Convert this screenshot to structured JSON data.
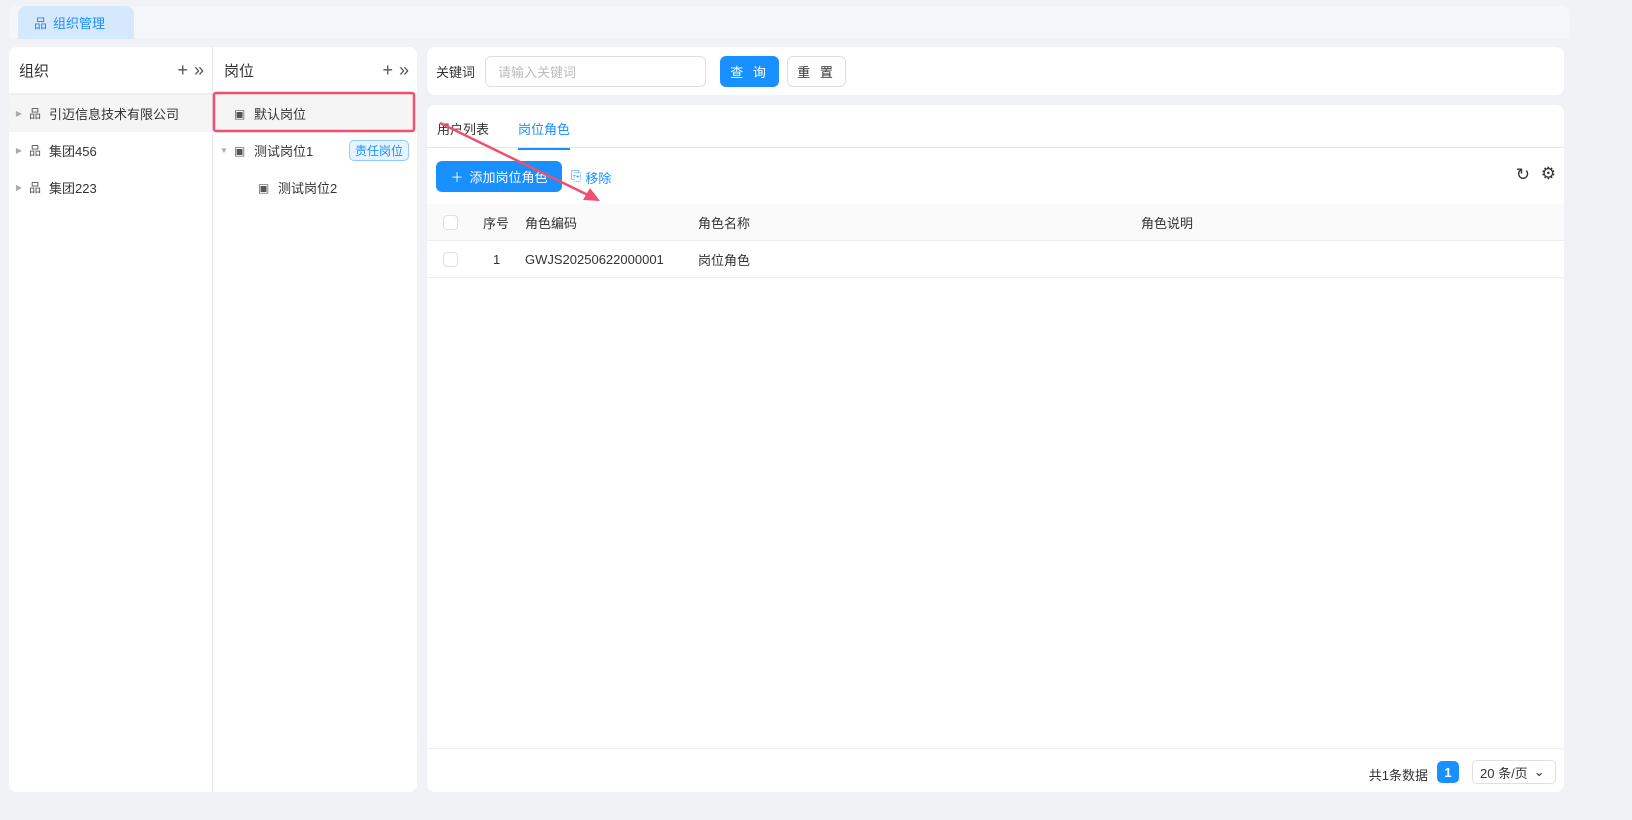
{
  "tabbar": {
    "tab": "组织管理"
  },
  "org": {
    "title": "组织",
    "items": [
      {
        "label": "引迈信息技术有限公司"
      },
      {
        "label": "集团456"
      },
      {
        "label": "集团223"
      }
    ]
  },
  "post": {
    "title": "岗位",
    "items": [
      {
        "label": "默认岗位"
      },
      {
        "label": "测试岗位1",
        "badge": "责任岗位"
      },
      {
        "label": "测试岗位2"
      }
    ]
  },
  "search": {
    "label": "关键词",
    "placeholder": "请输入关键词",
    "query": "查 询",
    "reset": "重 置"
  },
  "tabs": [
    {
      "label": "用户列表"
    },
    {
      "label": "岗位角色"
    }
  ],
  "toolbar": {
    "add": "添加岗位角色",
    "remove": "移除"
  },
  "table": {
    "headers": [
      "序号",
      "角色编码",
      "角色名称",
      "角色说明"
    ],
    "rows": [
      {
        "index": "1",
        "code": "GWJS20250622000001",
        "name": "岗位角色",
        "desc": ""
      }
    ]
  },
  "pagination": {
    "total": "共1条数据",
    "page": "1",
    "size": "20 条/页"
  },
  "colors": {
    "primary": "#1890ff",
    "annotation": "#f0506e"
  }
}
